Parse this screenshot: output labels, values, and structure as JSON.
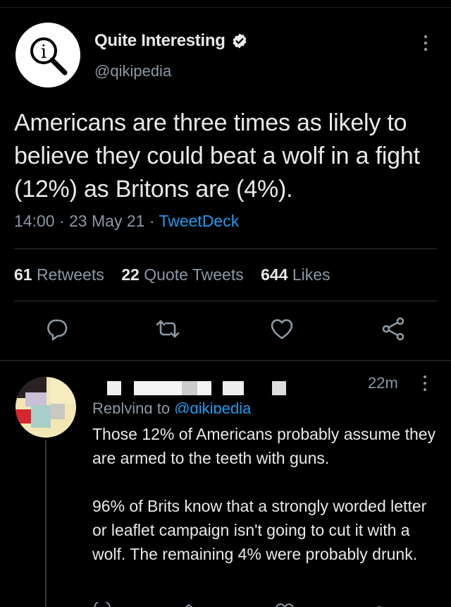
{
  "tweet": {
    "author_name": "Quite Interesting",
    "author_handle": "@qikipedia",
    "text": "Americans are three times as likely to believe they could beat a wolf in a fight (12%) as Britons are (4%).",
    "time": "14:00",
    "date": "23 May 21",
    "source": "TweetDeck",
    "stats": {
      "retweets_count": "61",
      "retweets_label": "Retweets",
      "quotes_count": "22",
      "quotes_label": "Quote Tweets",
      "likes_count": "644",
      "likes_label": "Likes"
    },
    "actions": [
      "reply-icon",
      "retweet-icon",
      "like-icon",
      "share-icon"
    ]
  },
  "reply": {
    "time": "22m",
    "replying_prefix": "Replying to",
    "replying_handle": "@qikipedia",
    "paragraph1": "Those 12% of Americans probably assume they are armed to the teeth with guns.",
    "paragraph2": "96% of Brits know that a strongly worded letter or leaflet campaign isn't going to cut it with a wolf. The remaining 4% were probably drunk."
  },
  "colors": {
    "background": "#000000",
    "text": "#e7e9ea",
    "muted": "#8b98a5",
    "link": "#1d9bf0"
  }
}
